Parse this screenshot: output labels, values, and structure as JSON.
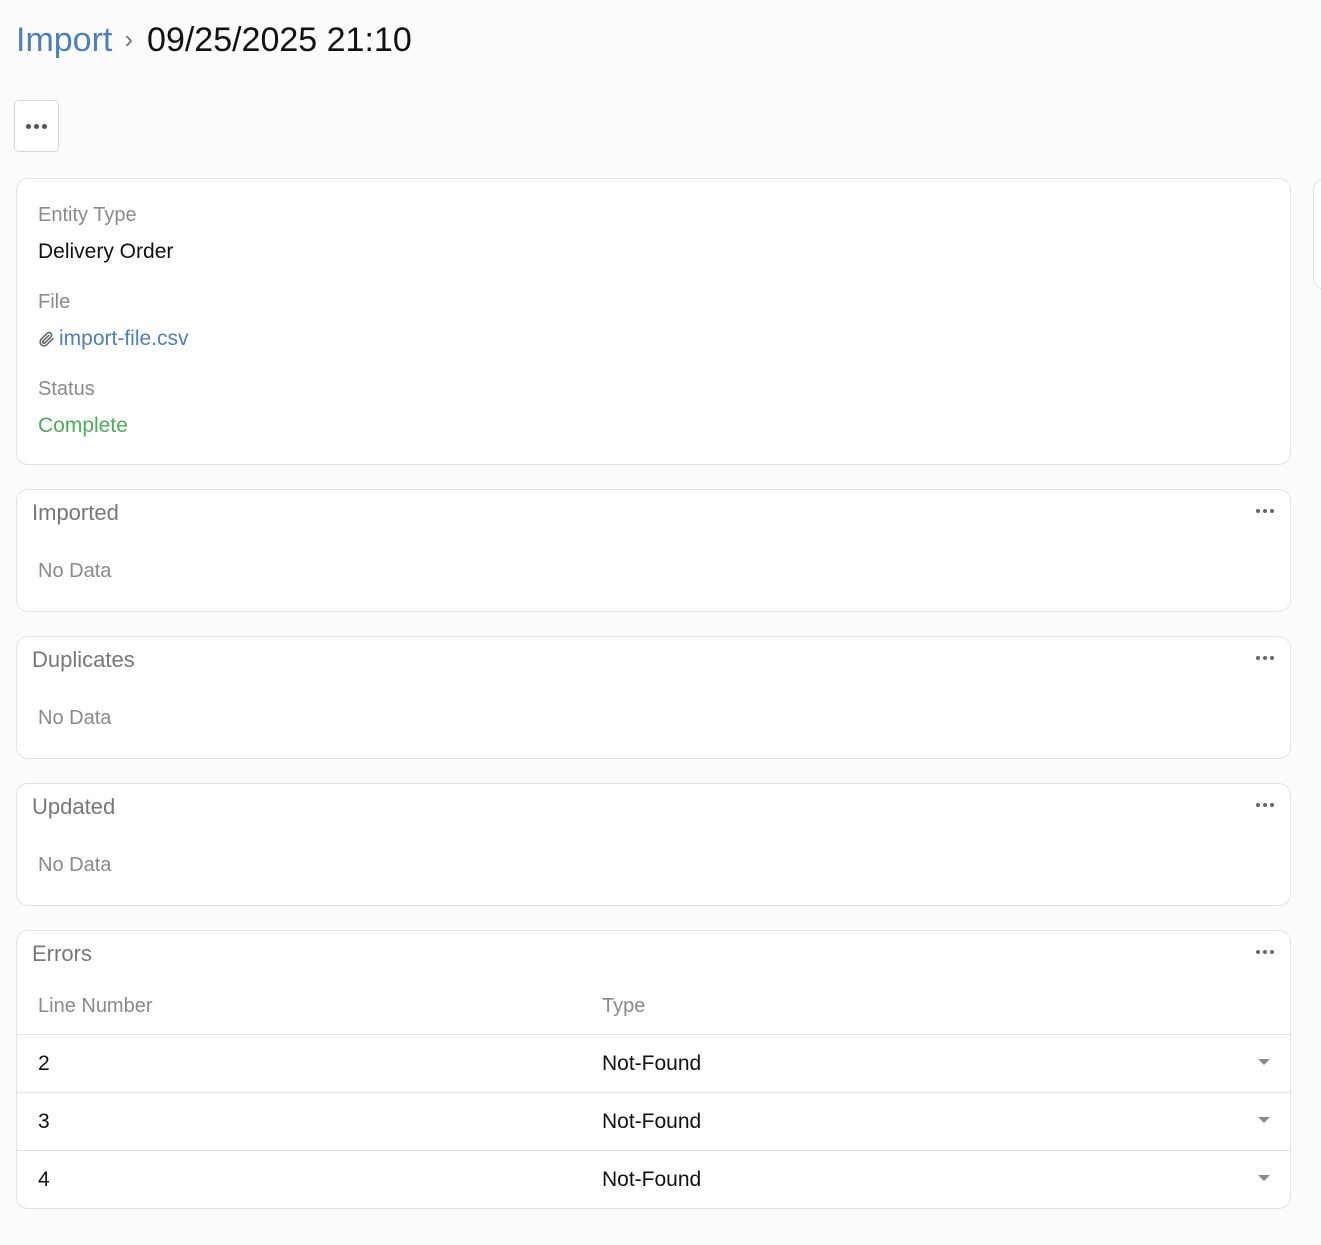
{
  "breadcrumb": {
    "parent": "Import",
    "separator": "›",
    "current": "09/25/2025 21:10"
  },
  "details": {
    "entity_type_label": "Entity Type",
    "entity_type_value": "Delivery Order",
    "file_label": "File",
    "file_value": "import-file.csv",
    "status_label": "Status",
    "status_value": "Complete"
  },
  "panels": {
    "imported": {
      "title": "Imported",
      "empty": "No Data"
    },
    "duplicates": {
      "title": "Duplicates",
      "empty": "No Data"
    },
    "updated": {
      "title": "Updated",
      "empty": "No Data"
    },
    "errors": {
      "title": "Errors",
      "columns": [
        "Line Number",
        "Type"
      ],
      "rows": [
        {
          "line": "2",
          "type": "Not-Found"
        },
        {
          "line": "3",
          "type": "Not-Found"
        },
        {
          "line": "4",
          "type": "Not-Found"
        }
      ]
    }
  },
  "icons": {
    "menu": "more-horizontal-icon",
    "file": "paperclip-icon",
    "row_expand": "caret-down-icon"
  },
  "colors": {
    "link": "#4a7fc1",
    "status_complete": "#4aaf57",
    "muted": "#8a8a8a"
  }
}
